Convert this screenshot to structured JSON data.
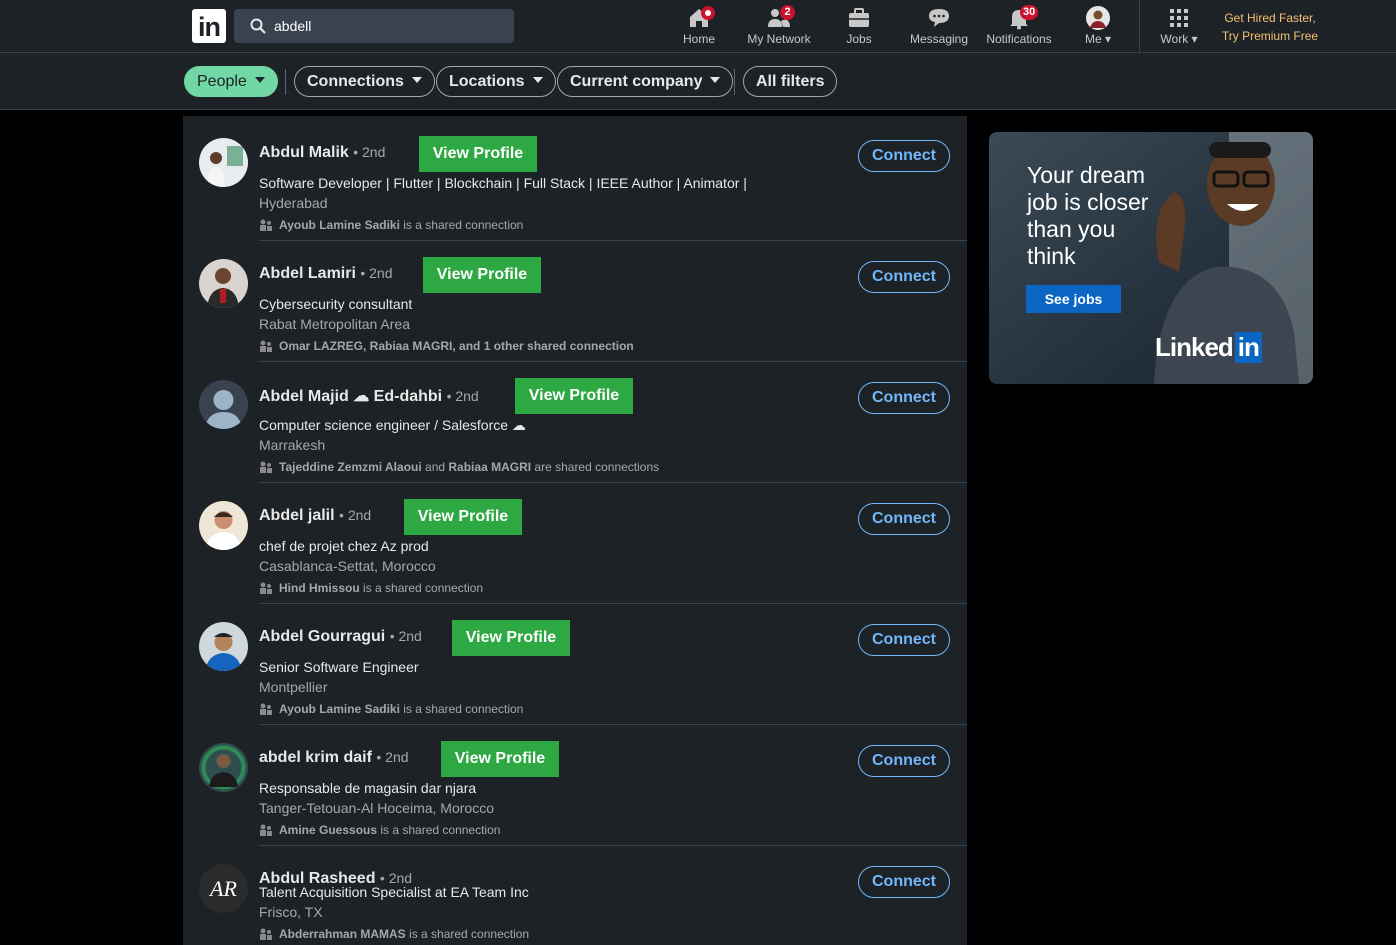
{
  "nav": {
    "search_value": "abdell",
    "items": [
      {
        "label": "Home",
        "icon": "home-icon"
      },
      {
        "label": "My Network",
        "icon": "network-icon",
        "badge": "2"
      },
      {
        "label": "Jobs",
        "icon": "briefcase-icon"
      },
      {
        "label": "Messaging",
        "icon": "messaging-icon"
      },
      {
        "label": "Notifications",
        "icon": "bell-icon",
        "badge": "30"
      },
      {
        "label": "Me",
        "icon": "avatar"
      },
      {
        "label": "Work",
        "icon": "grid-icon"
      }
    ],
    "premium_line1": "Get Hired Faster,",
    "premium_line2": "Try Premium Free"
  },
  "filters": {
    "people": "People",
    "connections": "Connections",
    "locations": "Locations",
    "current_company": "Current company",
    "all_filters": "All filters"
  },
  "results": [
    {
      "name": "Abdul Malik",
      "degree": "• 2nd",
      "view_profile": "View Profile",
      "headline": "Software Developer | Flutter | Blockchain | Full Stack | IEEE Author | Animator |",
      "location": "Hyderabad",
      "shared_names": "Ayoub Lamine Sadiki",
      "shared_suffix": " is a shared connection",
      "connect": "Connect"
    },
    {
      "name": "Abdel Lamiri",
      "degree": "• 2nd",
      "view_profile": "View Profile",
      "headline": "Cybersecurity consultant",
      "location": "Rabat Metropolitan Area",
      "shared_names": "Omar LAZREG, Rabiaa MAGRI, and 1 other shared connection",
      "shared_suffix": "",
      "connect": "Connect"
    },
    {
      "name": "Abdel Majid ☁ Ed-dahbi",
      "degree": "• 2nd",
      "view_profile": "View Profile",
      "headline": "Computer science engineer / Salesforce ☁",
      "location": "Marrakesh",
      "shared_names": "Tajeddine Zemzmi Alaoui",
      "shared_mid": " and ",
      "shared_names2": "Rabiaa MAGRI",
      "shared_suffix": " are shared connections",
      "connect": "Connect"
    },
    {
      "name": "Abdel jalil",
      "degree": "• 2nd",
      "view_profile": "View Profile",
      "headline": "chef de projet chez Az prod",
      "location": "Casablanca-Settat, Morocco",
      "shared_names": "Hind Hmissou",
      "shared_suffix": " is a shared connection",
      "connect": "Connect"
    },
    {
      "name": "Abdel Gourragui",
      "degree": "• 2nd",
      "view_profile": "View Profile",
      "headline": "Senior Software Engineer",
      "location": "Montpellier",
      "shared_names": "Ayoub Lamine Sadiki",
      "shared_suffix": " is a shared connection",
      "connect": "Connect"
    },
    {
      "name": "abdel krim daif",
      "degree": "• 2nd",
      "view_profile": "View Profile",
      "headline": "Responsable de magasin dar njara",
      "location": "Tanger-Tetouan-Al Hoceima, Morocco",
      "shared_names": "Amine Guessous",
      "shared_suffix": " is a shared connection",
      "connect": "Connect"
    },
    {
      "name": "Abdul Rasheed",
      "degree": "• 2nd",
      "view_profile": "",
      "headline": "Talent Acquisition Specialist at EA Team Inc",
      "location": "Frisco, TX",
      "shared_names": "Abderrahman MAMAS",
      "shared_suffix": " is a shared connection",
      "connect": "Connect"
    }
  ],
  "ad": {
    "headline": "Your dream job is closer than you think",
    "cta": "See jobs",
    "brand": "Linked",
    "brand_in": "in"
  },
  "colors": {
    "accent_green": "#2ea843",
    "connect_blue": "#71b7fb",
    "people_pill": "#71d7a5",
    "badge_red": "#cb112d",
    "premium_gold": "#f5c075"
  }
}
